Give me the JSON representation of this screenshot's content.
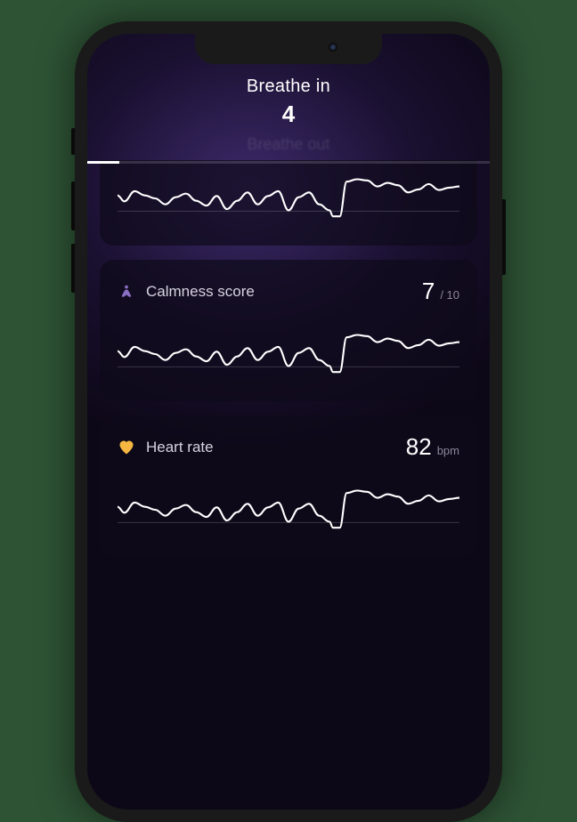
{
  "breathing": {
    "label": "Breathe in",
    "count": "4",
    "next_label": "Breathe out",
    "progress_percent": 8
  },
  "cards": {
    "calmness": {
      "title": "Calmness score",
      "value": "7",
      "unit": "/ 10",
      "icon_color": "#8b6fc4"
    },
    "heart": {
      "title": "Heart rate",
      "value": "82",
      "unit": "bpm",
      "icon_color": "#f5b742"
    }
  },
  "chart_data": [
    {
      "type": "line",
      "title": "",
      "xlabel": "",
      "ylabel": "",
      "x": [
        0,
        2,
        5,
        8,
        11,
        14,
        17,
        20,
        23,
        26,
        29,
        32,
        35,
        38,
        41,
        44,
        47,
        50,
        53,
        56,
        59,
        62,
        63,
        65,
        67,
        70,
        73,
        76,
        79,
        82,
        85,
        88,
        91,
        94,
        97,
        100
      ],
      "values": [
        55,
        45,
        62,
        55,
        50,
        40,
        52,
        58,
        46,
        38,
        54,
        32,
        46,
        60,
        40,
        54,
        62,
        30,
        52,
        60,
        40,
        30,
        20,
        20,
        78,
        82,
        80,
        70,
        76,
        72,
        60,
        65,
        74,
        64,
        68,
        70
      ]
    },
    {
      "type": "line",
      "title": "Calmness score",
      "xlabel": "",
      "ylabel": "",
      "x": [
        0,
        2,
        5,
        8,
        11,
        14,
        17,
        20,
        23,
        26,
        29,
        32,
        35,
        38,
        41,
        44,
        47,
        50,
        53,
        56,
        59,
        62,
        63,
        65,
        67,
        70,
        73,
        76,
        79,
        82,
        85,
        88,
        91,
        94,
        97,
        100
      ],
      "values": [
        55,
        45,
        62,
        55,
        50,
        40,
        52,
        58,
        46,
        38,
        54,
        32,
        46,
        60,
        40,
        54,
        62,
        30,
        52,
        60,
        40,
        30,
        20,
        20,
        78,
        82,
        80,
        70,
        76,
        72,
        60,
        65,
        74,
        64,
        68,
        70
      ]
    },
    {
      "type": "line",
      "title": "Heart rate",
      "xlabel": "",
      "ylabel": "",
      "x": [
        0,
        2,
        5,
        8,
        11,
        14,
        17,
        20,
        23,
        26,
        29,
        32,
        35,
        38,
        41,
        44,
        47,
        50,
        53,
        56,
        59,
        62,
        63,
        65,
        67,
        70,
        73,
        76,
        79,
        82,
        85,
        88,
        91,
        94,
        97,
        100
      ],
      "values": [
        55,
        45,
        62,
        55,
        50,
        40,
        52,
        58,
        46,
        38,
        54,
        32,
        46,
        60,
        40,
        54,
        62,
        30,
        52,
        60,
        40,
        30,
        20,
        20,
        78,
        82,
        80,
        70,
        76,
        72,
        60,
        65,
        74,
        64,
        68,
        70
      ]
    }
  ]
}
